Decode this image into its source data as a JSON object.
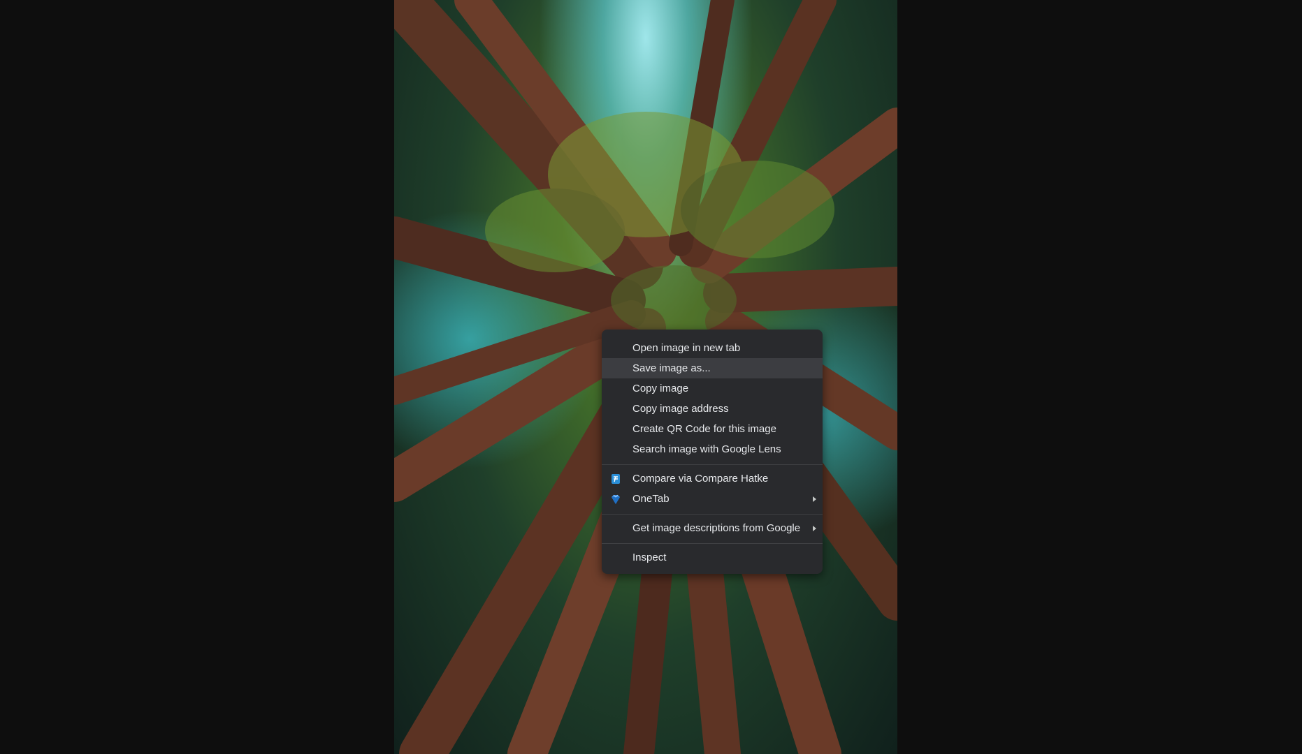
{
  "context_menu": {
    "groups": [
      [
        {
          "label": "Open image in new tab"
        },
        {
          "label": "Save image as...",
          "highlighted": true
        },
        {
          "label": "Copy image"
        },
        {
          "label": "Copy image address"
        },
        {
          "label": "Create QR Code for this image"
        },
        {
          "label": "Search image with Google Lens"
        }
      ],
      [
        {
          "label": "Compare via Compare Hatke",
          "icon": "compare-hatke-icon"
        },
        {
          "label": "OneTab",
          "icon": "onetab-icon",
          "submenu": true
        }
      ],
      [
        {
          "label": "Get image descriptions from Google",
          "submenu": true
        }
      ],
      [
        {
          "label": "Inspect"
        }
      ]
    ]
  },
  "colors": {
    "page_background": "#0e0e0e",
    "menu_background": "#292a2d",
    "menu_hover": "#3c3d41",
    "menu_text": "#e8eaed"
  }
}
